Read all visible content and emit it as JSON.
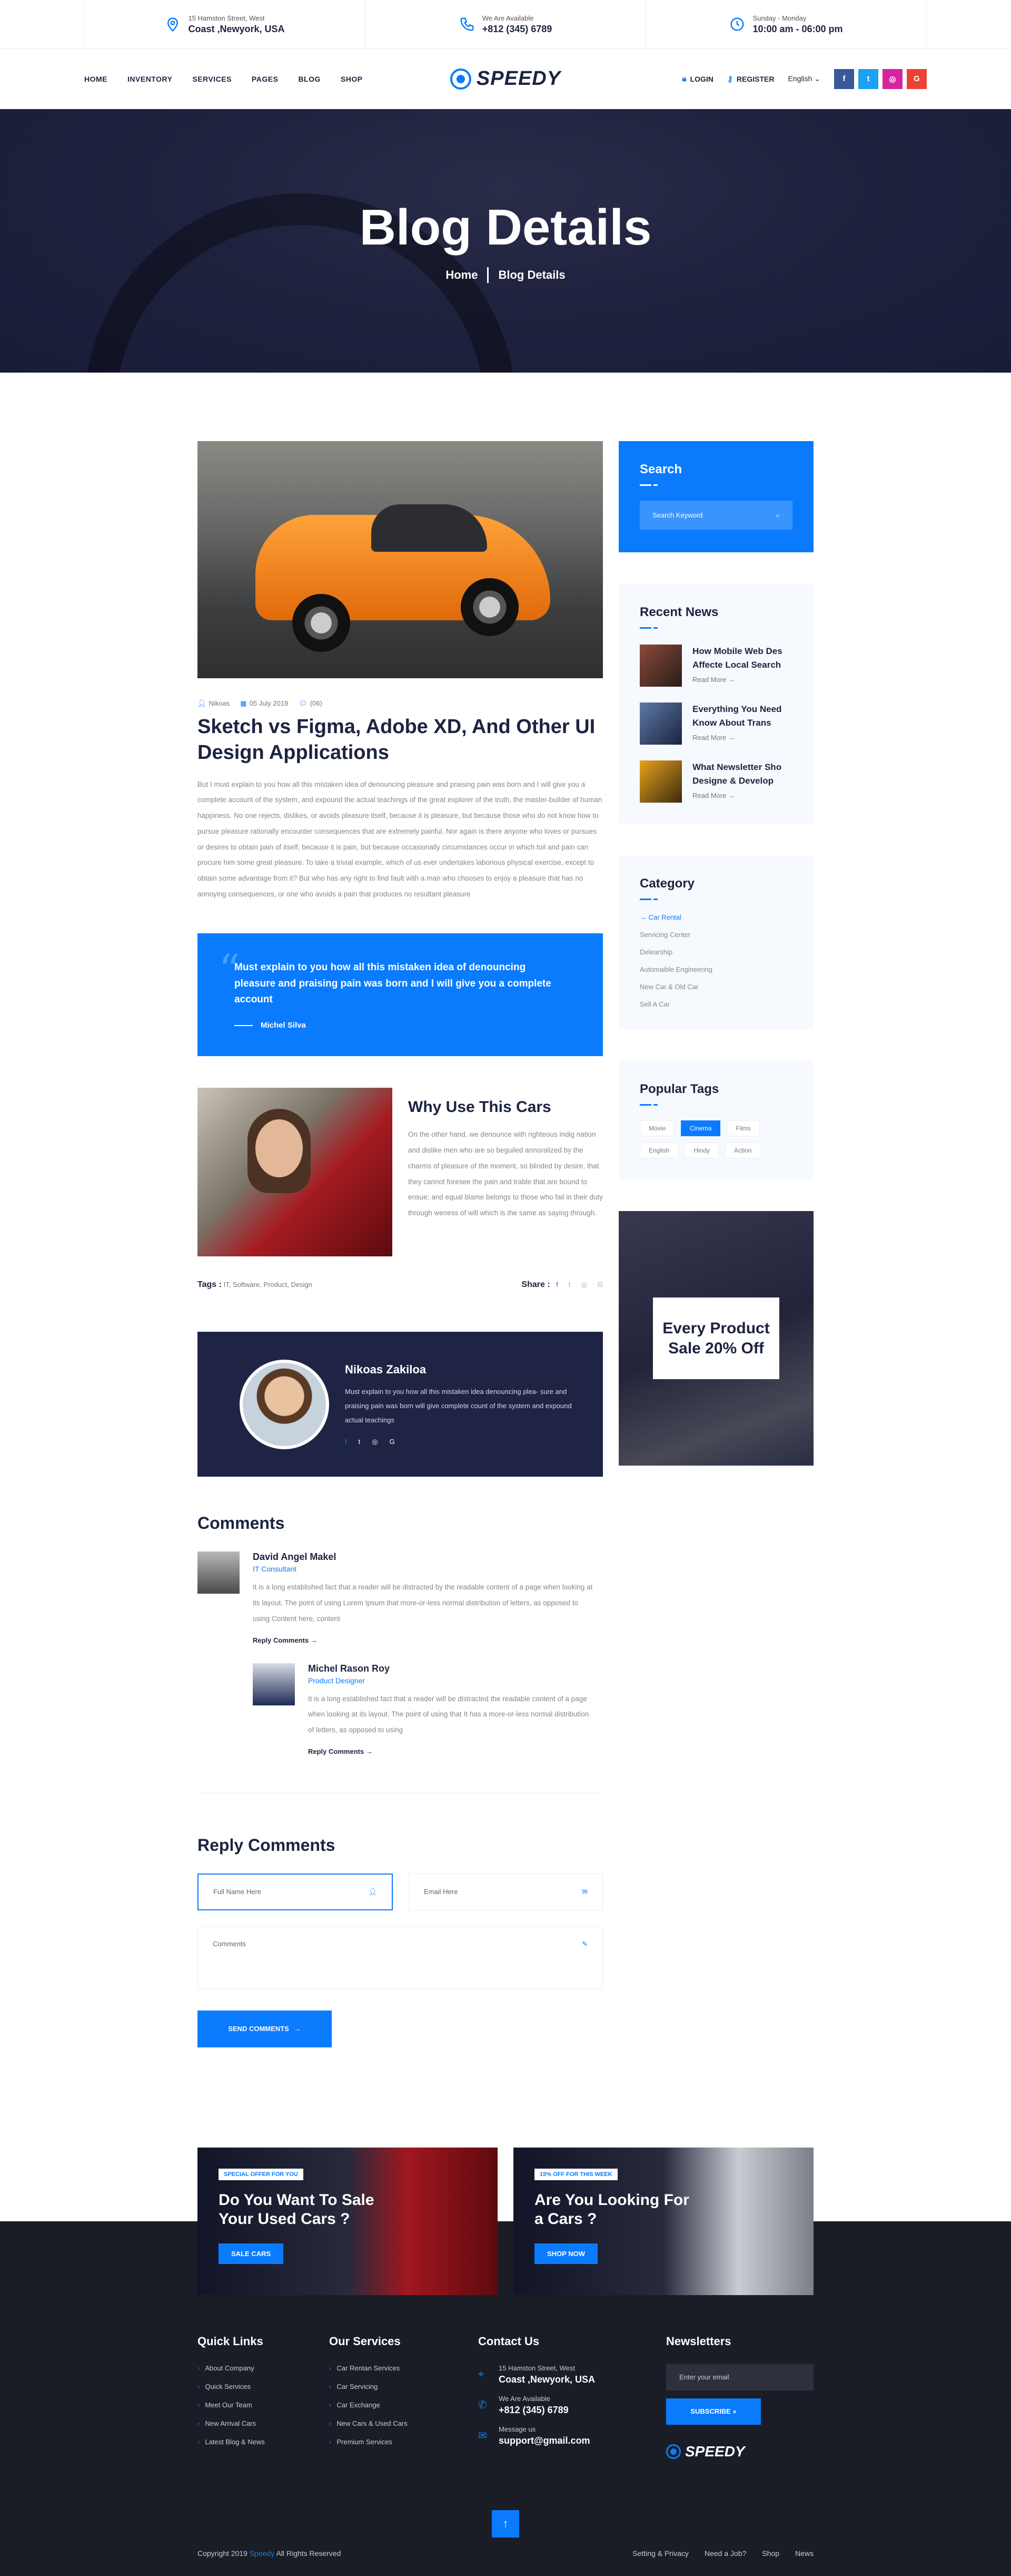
{
  "topbar": {
    "address": {
      "small": "15 Hamston Street, West",
      "big": "Coast ,Newyork, USA"
    },
    "phone": {
      "small": "We Are Available",
      "big": "+812 (345) 6789"
    },
    "hours": {
      "small": "Sunday - Monday",
      "big": "10:00 am - 06:00 pm"
    }
  },
  "nav": {
    "menu": [
      "HOME",
      "INVENTORY",
      "SERVICES",
      "PAGES",
      "BLOG",
      "SHOP"
    ],
    "logo": "SPEEDY",
    "login": "LOGIN",
    "register": "REGISTER",
    "language": "English",
    "socials": [
      {
        "label": "f",
        "color": "#3b5998"
      },
      {
        "label": "t",
        "color": "#1da1f2"
      },
      {
        "label": "◎",
        "color": "#d6249f"
      },
      {
        "label": "G",
        "color": "#ea4335"
      }
    ]
  },
  "hero": {
    "title": "Blog Details",
    "crumb_home": "Home",
    "crumb_current": "Blog Details"
  },
  "post": {
    "author": "Nikoas",
    "date": "05 July 2019",
    "comments": "(06)",
    "title": "Sketch vs Figma, Adobe XD, And Other UI Design Applications",
    "body": "But I must explain to you how all this mistaken idea of denouncing pleasure and praising pain was born and I will give you a complete account of the system, and expound the actual teachings of the great explorer of the truth, the master-builder of human happiness. No one rejects, dislikes, or avoids pleasure itself, because it is pleasure, but because those who do not know how to pursue pleasure rationally encounter consequences that are extremely painful. Nor again is there anyone who loves or pursues or desires to obtain pain of itself, because it is pain, but because occasionally circumstances occur in which toil and pain can procure him some great pleasure. To take a trivial example, which of us ever undertakes laborious physical exercise, except to obtain some advantage from it? But who has any right to find fault with a man who chooses to enjoy a pleasure that has no annoying consequences, or one who avoids a pain that produces no resultant pleasure",
    "quote": "Must explain to you how all this mistaken idea of denouncing pleasure and praising pain was born and I will give you a complete account",
    "quote_author": "Michel Silva",
    "why_title": "Why Use This Cars",
    "why_text": "On the other hand, we denounce with righteous indig nation and dislike men who are so beguiled annoralized by the charms of pleasure of the moment, so blinded by desire, that they cannot foresee the pain and trable that are bound to ensue; and equal blame belongs to those who fail in their duty through weness of will which is the same as saying through.",
    "tags_label": "Tags :",
    "tags": "IT, Software, Product, Design",
    "share_label": "Share :",
    "share_icons": [
      "f",
      "t",
      "◎",
      "G"
    ]
  },
  "author_box": {
    "name": "Nikoas Zakiloa",
    "text": "Must explain to you how all this mistaken idea denouncing plea- sure and praising pain was born will give complete count of the system and expound actual teachings",
    "socials": [
      "f",
      "t",
      "◎",
      "G"
    ]
  },
  "comments": {
    "title": "Comments",
    "items": [
      {
        "name": "David Angel Makel",
        "role": "IT Consultant",
        "text": "It is a long established fact that a reader will be distracted by the readable content of a page when looking at its layout. The point of using Lorem Ipsum that more-or-less normal distribution of letters, as opposed to using Content here, content",
        "reply": "Reply Comments"
      },
      {
        "name": "Michel Rason Roy",
        "role": "Product Designer",
        "text": "It is a long established fact that a reader will be distracted the readable content of a page when looking at its layout. The point of using that It has a more-or-less normal distribution of letters, as opposed to using",
        "reply": "Reply Comments"
      }
    ]
  },
  "reply_form": {
    "title": "Reply Comments",
    "name_placeholder": "Full Name Here",
    "email_placeholder": "Email Here",
    "comment_placeholder": "Comments",
    "submit": "SEND COMMENTS"
  },
  "sidebar": {
    "search_title": "Search",
    "search_placeholder": "Search Keyword",
    "news_title": "Recent News",
    "news": [
      {
        "title": "How Mobile Web Des Affecte Local Search",
        "more": "Read More"
      },
      {
        "title": "Everything You Need Know About Trans",
        "more": "Read More"
      },
      {
        "title": "What Newsletter Sho Designe & Develop",
        "more": "Read More"
      }
    ],
    "category_title": "Category",
    "categories": [
      "Car Rental",
      "Servicing Center",
      "Delearship",
      "Automaible Engineering",
      "New Car & Old Car",
      "Sell A Car"
    ],
    "tags_title": "Popular Tags",
    "tags": [
      "Movie",
      "Cinema",
      "Films",
      "English",
      "Hindy",
      "Action"
    ],
    "promo": "Every Product Sale 20% Off"
  },
  "banners": [
    {
      "badge": "SPECIAL OFFER FOR YOU",
      "title": "Do You Want To Sale Your Used Cars ?",
      "button": "SALE CARS"
    },
    {
      "badge": "15% OFF FOR THIS WEEK",
      "title": "Are You Looking For a Cars ?",
      "button": "SHOP NOW"
    }
  ],
  "footer": {
    "quick_title": "Quick Links",
    "quick": [
      "About Company",
      "Quick Services",
      "Meet Our Team",
      "New Arrival Cars",
      "Latest Blog & News"
    ],
    "services_title": "Our Services",
    "services": [
      "Car Rentan Services",
      "Car Servicing",
      "Car Exchange",
      "New Cars & Used Cars",
      "Premium Services"
    ],
    "contact_title": "Contact Us",
    "contact": [
      {
        "small": "15 Hamston Street, West",
        "big": "Coast ,Newyork, USA"
      },
      {
        "small": "We Are Available",
        "big": "+812 (345) 6789"
      },
      {
        "small": "Message us",
        "big": "support@gmail.com"
      }
    ],
    "newsletter_title": "Newsletters",
    "newsletter_placeholder": "Enter your email",
    "subscribe": "SUBSCRIBE",
    "logo": "SPEEDY",
    "copyright_pre": "Copyright 2019",
    "copyright_brand": "Speedy",
    "copyright_post": "All Rights Reserved",
    "bottom_links": [
      "Setting & Privacy",
      "Need a Job?",
      "Shop",
      "News"
    ]
  }
}
